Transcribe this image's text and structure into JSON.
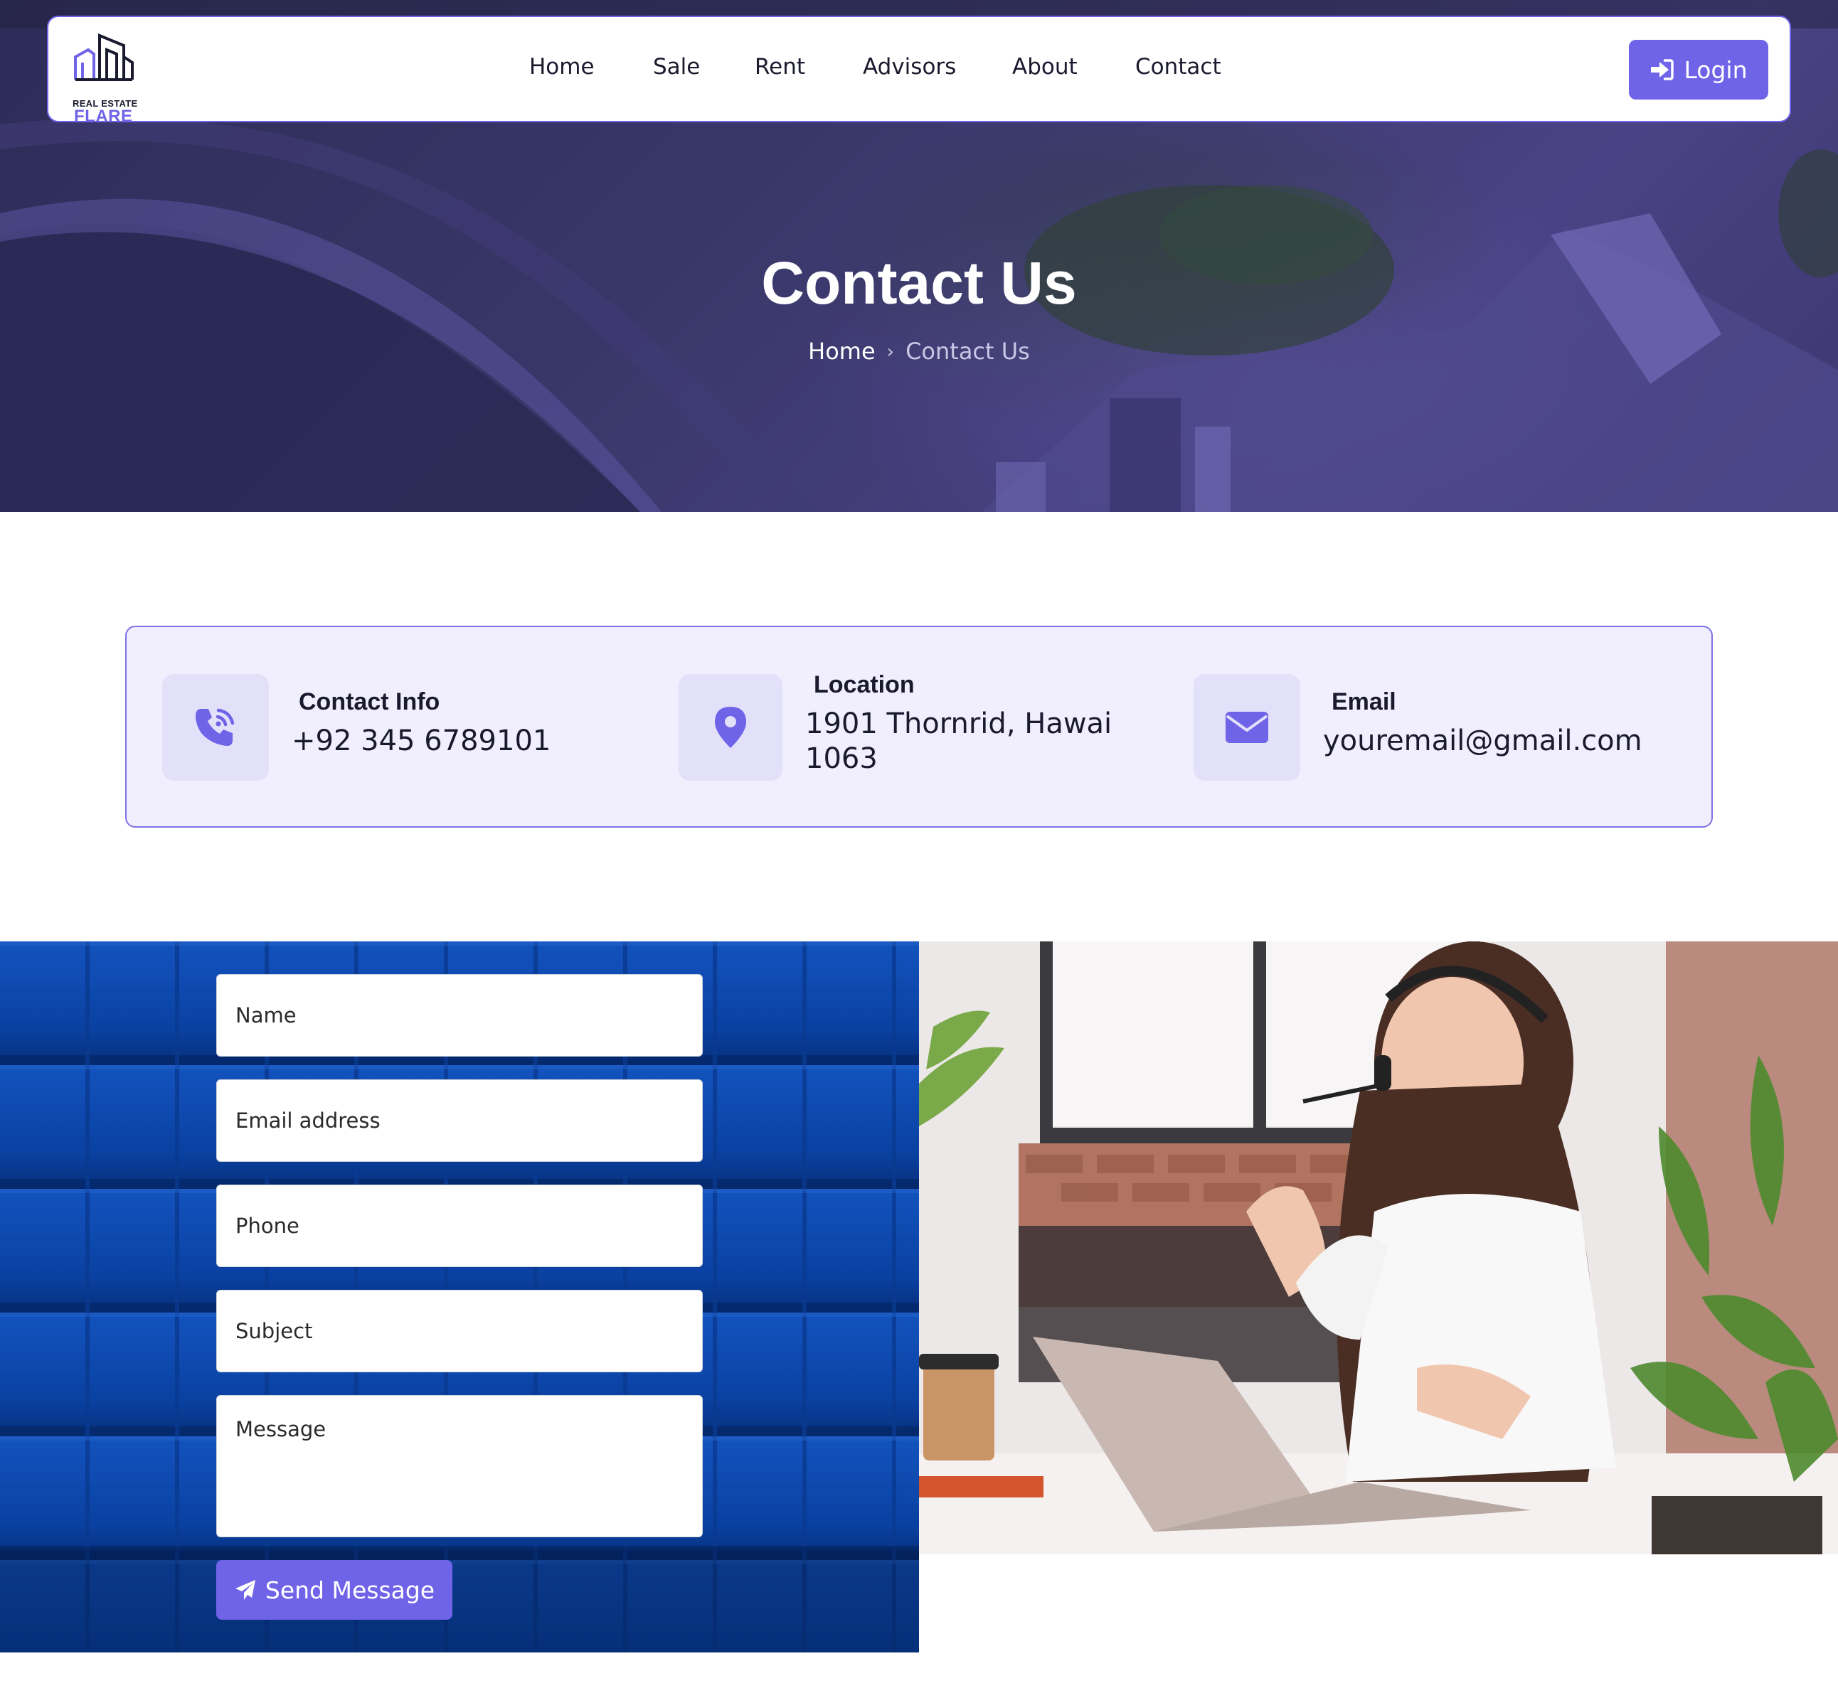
{
  "brand": {
    "logo_top": "REAL ESTATE",
    "logo_bottom": "FLARE"
  },
  "nav": {
    "items": [
      "Home",
      "Sale",
      "Rent",
      "Advisors",
      "About",
      "Contact"
    ],
    "login_label": "Login"
  },
  "hero": {
    "title": "Contact Us",
    "breadcrumb_home": "Home",
    "breadcrumb_separator": "›",
    "breadcrumb_current": "Contact Us"
  },
  "info": {
    "items": [
      {
        "icon": "phone-icon",
        "title": "Contact Info",
        "value": "+92 345 6789101"
      },
      {
        "icon": "location-pin-icon",
        "title": "Location",
        "value": "1901 Thornrid, Hawai 1063"
      },
      {
        "icon": "envelope-icon",
        "title": "Email",
        "value": "youremail@gmail.com"
      }
    ]
  },
  "form": {
    "name_placeholder": "Name",
    "email_placeholder": "Email address",
    "phone_placeholder": "Phone",
    "subject_placeholder": "Subject",
    "message_placeholder": "Message",
    "submit_label": "Send Message"
  },
  "colors": {
    "accent": "#6f63e8",
    "info_card_bg": "#f1effd",
    "icon_box_bg": "#e3e0fa",
    "hero_overlay": "#393769",
    "form_bg": "#0a3f98"
  }
}
